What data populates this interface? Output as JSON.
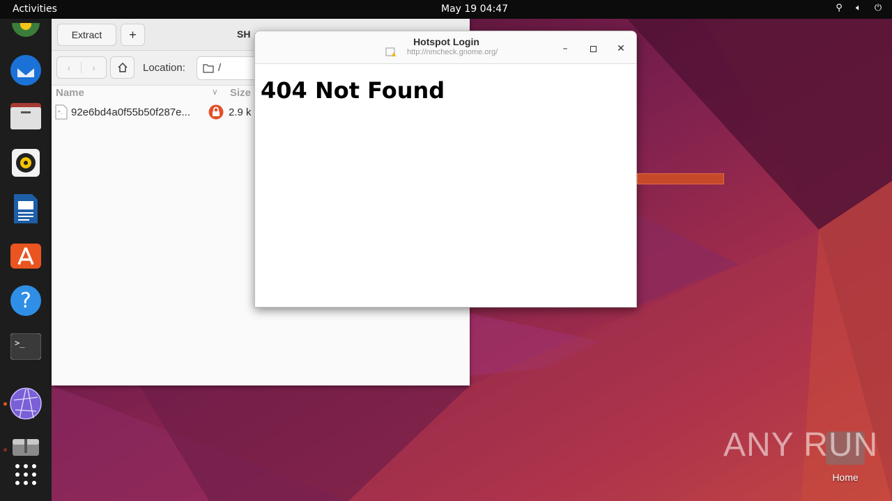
{
  "topbar": {
    "activities": "Activities",
    "clock": "May 19  04:47",
    "tray_icons": [
      "network-icon",
      "volume-icon",
      "power-icon"
    ]
  },
  "dock": {
    "apps": [
      "chrome",
      "thunderbird",
      "files",
      "rhythmbox",
      "libreoffice-writer",
      "app-center",
      "help",
      "terminal",
      "web-browser",
      "archive-manager",
      "show-apps"
    ]
  },
  "file_roller": {
    "extract_label": "Extract",
    "add_label": "+",
    "title": "SH",
    "location_label": "Location:",
    "location_value": "/",
    "columns": {
      "name": "Name",
      "size": "Size"
    },
    "files": [
      {
        "name": "92e6bd4a0f55b50f287e...",
        "size": "2.9 k"
      }
    ]
  },
  "hotspot": {
    "title": "Hotspot Login",
    "url": "http://nmcheck.gnome.org/",
    "heading": "404 Not Found"
  },
  "desktop": {
    "watermark": "ANY RUN",
    "home_label": "Home"
  },
  "colors": {
    "accent": "#e95420",
    "topbar": "#0c0c0c",
    "dock": "#1d1d1d"
  }
}
